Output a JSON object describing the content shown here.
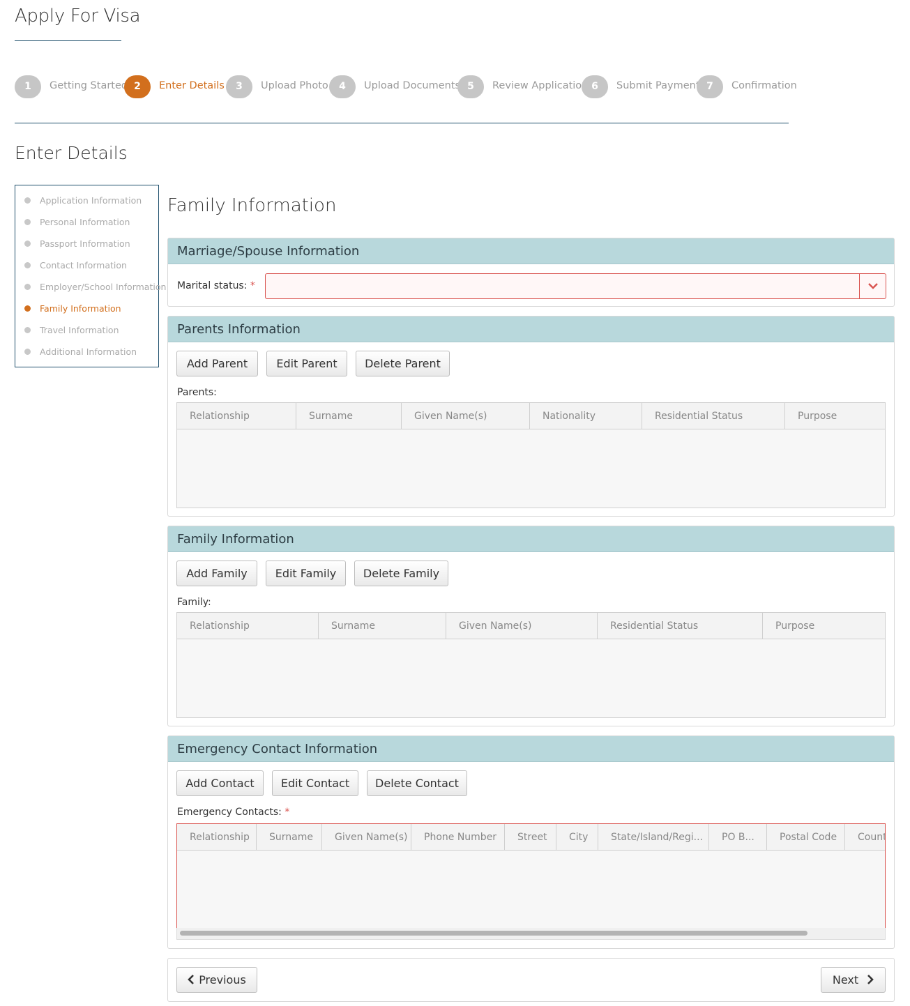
{
  "app": {
    "title": "Apply For Visa"
  },
  "stepper": {
    "steps": [
      {
        "number": "1",
        "label": "Getting Started"
      },
      {
        "number": "2",
        "label": "Enter Details"
      },
      {
        "number": "3",
        "label": "Upload Photo"
      },
      {
        "number": "4",
        "label": "Upload Documents"
      },
      {
        "number": "5",
        "label": "Review Application"
      },
      {
        "number": "6",
        "label": "Submit Payment"
      },
      {
        "number": "7",
        "label": "Confirmation"
      }
    ],
    "active_step": "2"
  },
  "section": {
    "title": "Enter Details"
  },
  "sidebar": {
    "items": [
      {
        "label": "Application Information"
      },
      {
        "label": "Personal Information"
      },
      {
        "label": "Passport Information"
      },
      {
        "label": "Contact Information"
      },
      {
        "label": "Employer/School Information"
      },
      {
        "label": "Family Information"
      },
      {
        "label": "Travel Information"
      },
      {
        "label": "Additional Information"
      }
    ],
    "active_item": "Family Information"
  },
  "page": {
    "heading": "Family Information"
  },
  "marriage": {
    "title": "Marriage/Spouse Information",
    "marital_label": "Marital status:",
    "required_mark": "*",
    "marital_value": ""
  },
  "parents": {
    "title": "Parents Information",
    "add": "Add Parent",
    "edit": "Edit Parent",
    "delete": "Delete Parent",
    "list_label": "Parents:",
    "columns": [
      "Relationship",
      "Surname",
      "Given Name(s)",
      "Nationality",
      "Residential Status",
      "Purpose"
    ]
  },
  "family": {
    "title": "Family Information",
    "add": "Add Family",
    "edit": "Edit Family",
    "delete": "Delete Family",
    "list_label": "Family:",
    "columns": [
      "Relationship",
      "Surname",
      "Given Name(s)",
      "Residential Status",
      "Purpose"
    ]
  },
  "emergency": {
    "title": "Emergency Contact Information",
    "add": "Add Contact",
    "edit": "Edit Contact",
    "delete": "Delete Contact",
    "list_label": "Emergency Contacts:",
    "required_mark": "*",
    "columns": [
      "Relationship",
      "Surname",
      "Given Name(s)",
      "Phone Number",
      "Street",
      "City",
      "State/Island/Regi...",
      "PO B...",
      "Postal Code",
      "Count"
    ]
  },
  "footer": {
    "previous": "Previous",
    "next": "Next"
  },
  "colors": {
    "accent": "#d26f1d",
    "panel_header": "#b8d8dc",
    "rule": "#1d4e6b",
    "error": "#d9534f"
  },
  "icons": {
    "chevron_down": "chevron-down-icon",
    "chevron_left": "chevron-left-icon",
    "chevron_right": "chevron-right-icon"
  }
}
